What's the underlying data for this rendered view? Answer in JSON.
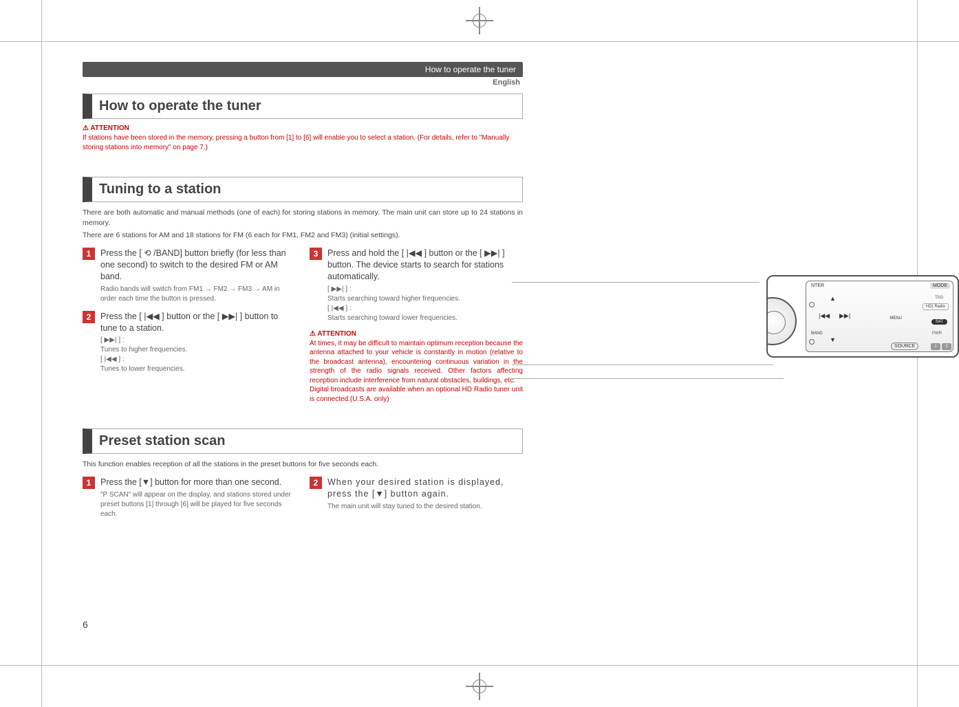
{
  "header": {
    "breadcrumb": "How to operate the tuner",
    "language": "English"
  },
  "section_operate": {
    "title": "How to operate the tuner",
    "attention_label": "ATTENTION",
    "attention_text": "If stations have been stored in the memory, pressing a button from [1] to [6] will enable you to select a station. (For details, refer to \"Manually storing stations into memory\" on page 7.)"
  },
  "section_tuning": {
    "title": "Tuning to a station",
    "intro1": "There are both automatic and manual methods (one of each) for storing stations in memory. The main unit can store up to 24 stations in memory.",
    "intro2": "There are 6 stations for AM and 18 stations for FM (6 each for FM1, FM2 and FM3) (initial settings).",
    "step1": {
      "num": "1",
      "head": "Press the [ ⟲ /BAND] button briefly (for less than one second) to switch to the desired FM or AM band.",
      "desc": "Radio bands will switch from FM1 → FM2 → FM3 → AM in order each time the button is pressed."
    },
    "step2": {
      "num": "2",
      "head": "Press the [ |◀◀ ] button or the [ ▶▶| ] button to tune to a station.",
      "desc": "[ ▶▶| ] :\nTunes to higher frequencies.\n[ |◀◀ ] :\nTunes to lower frequencies."
    },
    "step3": {
      "num": "3",
      "head": "Press and hold the [ |◀◀ ] button or the [ ▶▶| ] button. The device starts to search for stations automatically.",
      "desc": "[ ▶▶| ] :\nStarts searching toward higher frequencies.\n[ |◀◀ ] :\nStarts searching toward lower frequencies."
    },
    "attention_label": "ATTENTION",
    "attention_text": "At times, it may be difficult to maintain optimum reception because the antenna attached to your vehicle is constantly in motion (relative to the broadcast antenna), encountering continuous variation in the strength of the radio signals received. Other factors affecting reception include interference from natural obstacles, buildings, etc.\nDigital broadcasts are available when an optional HD Radio tuner unit is connected.(U.S.A. only)"
  },
  "section_preset": {
    "title": "Preset station scan",
    "intro": "This function enables reception of all the stations in the preset buttons for five seconds each.",
    "step1": {
      "num": "1",
      "head": "Press the [▼] button for more than one second.",
      "desc": "\"P SCAN\" will appear on the display, and stations stored under preset buttons [1] through [6] will be played for five seconds each."
    },
    "step2": {
      "num": "2",
      "head": "When your desired station is displayed, press the [▼] button again.",
      "desc": "The main unit will stay tuned to the desired station."
    }
  },
  "page_number": "6",
  "stereo": {
    "mode": "MODE",
    "tag": "TAG",
    "hd": "HD) Radio",
    "sat": "SAT",
    "pwr": "PWR",
    "source": "SOURCE",
    "nter": "NTER",
    "band": "BAND",
    "menu": "MENU",
    "btn1": "1",
    "btn2": "2"
  }
}
